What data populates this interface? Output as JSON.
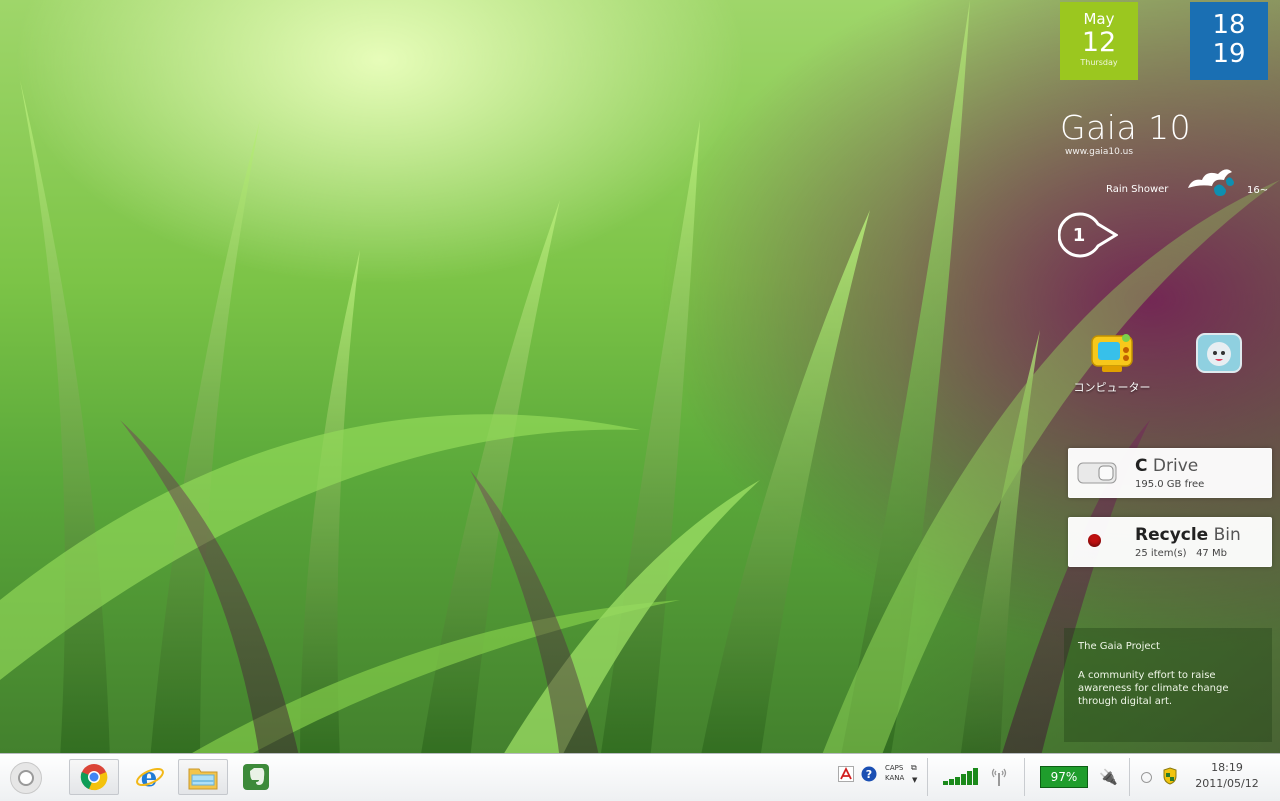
{
  "date_tile": {
    "month": "May",
    "day": "12",
    "weekday": "Thursday"
  },
  "time_tile": {
    "hour": "18",
    "minute": "19"
  },
  "brand": {
    "title": "Gaia 10",
    "url": "www.gaia10.us"
  },
  "weather": {
    "condition": "Rain Shower",
    "temperature": "16",
    "icon": "rain-cloud-icon"
  },
  "badge": {
    "count": "1"
  },
  "desktop_icons": [
    {
      "label": "コンピューター",
      "icon": "computer-icon"
    },
    {
      "label": "",
      "icon": "cat-folder-icon"
    }
  ],
  "drive_gadget": {
    "title_bold": "C",
    "title_light": "Drive",
    "free": "195.0 GB free"
  },
  "recycle_gadget": {
    "title_bold": "Recycle",
    "title_light": "Bin",
    "items": "25 item(s)",
    "size": "47 Mb"
  },
  "info_panel": {
    "heading": "The Gaia Project",
    "text": "A community effort to raise awareness for climate change through digital art."
  },
  "taskbar": {
    "apps": [
      "chrome-icon",
      "internet-explorer-icon",
      "file-explorer-icon",
      "evernote-icon"
    ],
    "caps_label": "CAPS",
    "kana_label": "KANA",
    "battery_percent": "97%",
    "clock_time": "18:19",
    "clock_date": "2011/05/12"
  },
  "colors": {
    "date_tile": "#9bc71f",
    "time_tile": "#1a6fb3",
    "battery": "#1f9d2c"
  }
}
